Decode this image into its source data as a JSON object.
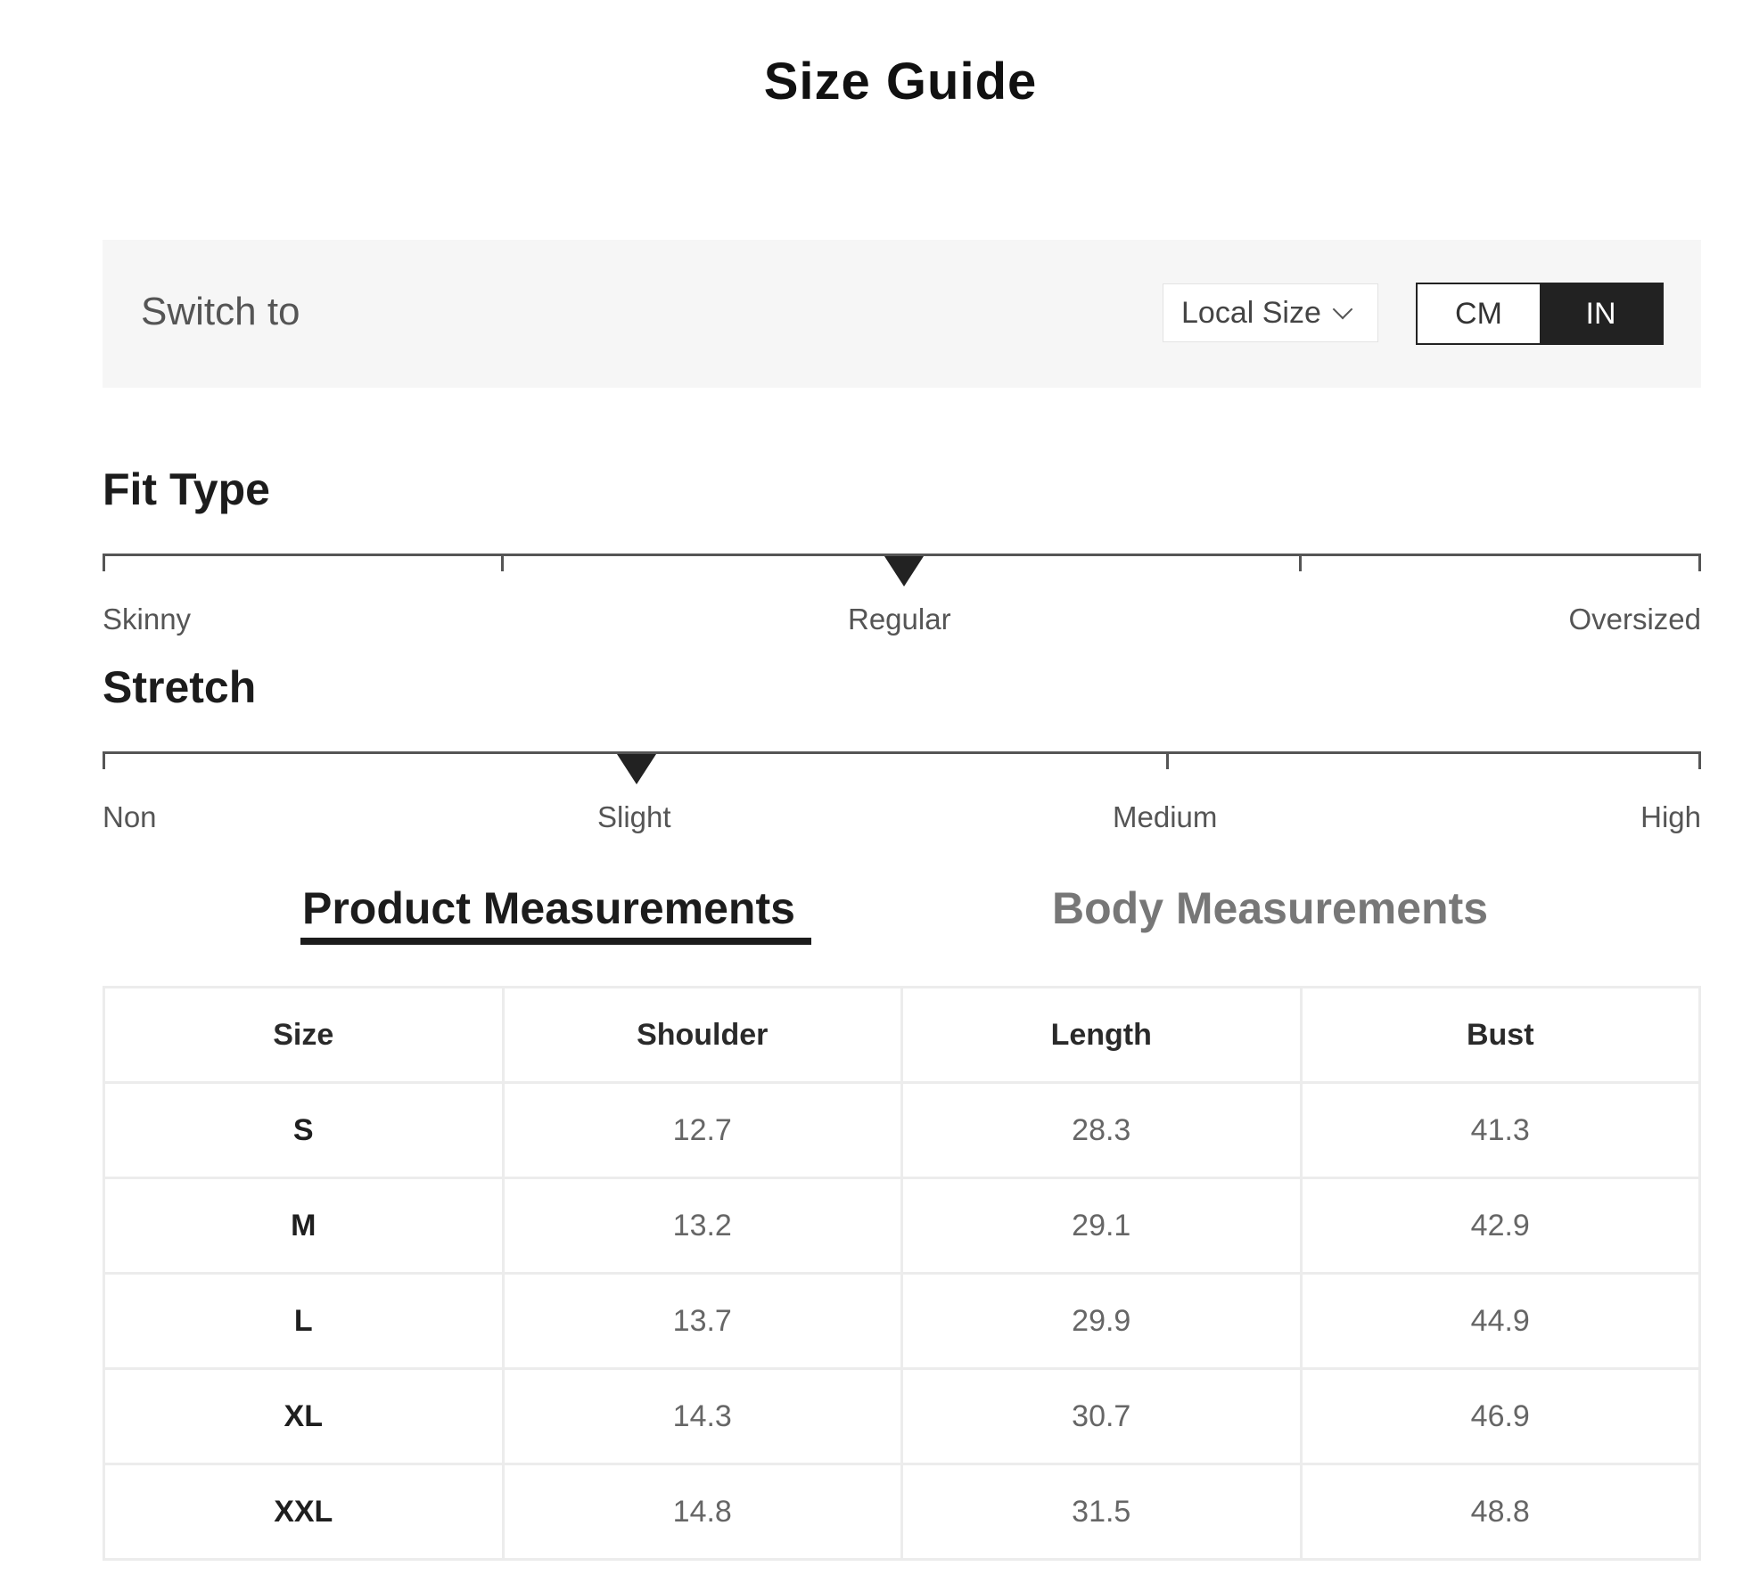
{
  "header": {
    "title": "Size Guide"
  },
  "switch_bar": {
    "label": "Switch to",
    "size_select": {
      "selected": "Local Size"
    },
    "unit_toggle": {
      "options": [
        "CM",
        "IN"
      ],
      "selected": "IN"
    }
  },
  "fit_type": {
    "heading": "Fit Type",
    "labels": [
      "Skinny",
      "Regular",
      "Oversized"
    ],
    "selected": "Regular",
    "level_fraction": 0.5
  },
  "stretch": {
    "heading": "Stretch",
    "labels": [
      "Non",
      "Slight",
      "Medium",
      "High"
    ],
    "selected": "Slight",
    "level_fraction": 0.333
  },
  "tabs": [
    {
      "label": "Product Measurements",
      "active": true
    },
    {
      "label": "Body Measurements",
      "active": false
    }
  ],
  "table": {
    "columns": [
      "Size",
      "Shoulder",
      "Length",
      "Bust"
    ],
    "rows": [
      [
        "S",
        "12.7",
        "28.3",
        "41.3"
      ],
      [
        "M",
        "13.2",
        "29.1",
        "42.9"
      ],
      [
        "L",
        "13.7",
        "29.9",
        "44.9"
      ],
      [
        "XL",
        "14.3",
        "30.7",
        "46.9"
      ],
      [
        "XXL",
        "14.8",
        "31.5",
        "48.8"
      ]
    ]
  },
  "colors": {
    "accent": "#222222",
    "panel_background": "#f6f6f6",
    "muted_text": "#666666",
    "border": "#ececec"
  }
}
